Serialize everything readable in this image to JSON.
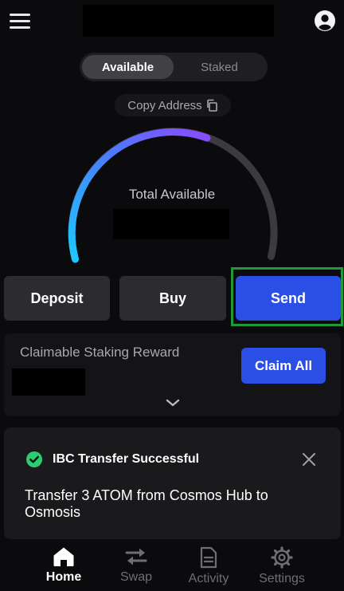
{
  "header": {
    "menu_icon": "hamburger-menu-icon",
    "profile_icon": "account-circle-icon"
  },
  "balance_tabs": [
    {
      "label": "Available",
      "active": true
    },
    {
      "label": "Staked",
      "active": false
    }
  ],
  "copy_address": {
    "label": "Copy Address",
    "icon": "copy-icon"
  },
  "gauge": {
    "label": "Total Available",
    "gradient_start": "#1ec8ff",
    "gradient_end": "#8a4bff",
    "track_color": "#3a3a40"
  },
  "actions": {
    "deposit_label": "Deposit",
    "buy_label": "Buy",
    "send_label": "Send"
  },
  "claim": {
    "label": "Claimable Staking Reward",
    "button_label": "Claim All",
    "expand_icon": "chevron-down-icon"
  },
  "toast": {
    "icon": "check-circle-icon",
    "title": "IBC Transfer Successful",
    "message": "Transfer 3 ATOM from Cosmos Hub to Osmosis",
    "close_icon": "close-icon"
  },
  "nav": [
    {
      "label": "Home",
      "icon": "home-icon",
      "active": true
    },
    {
      "label": "Swap",
      "icon": "swap-arrows-icon",
      "active": false
    },
    {
      "label": "Activity",
      "icon": "document-icon",
      "active": false
    },
    {
      "label": "Settings",
      "icon": "gear-icon",
      "active": false
    }
  ],
  "colors": {
    "background": "#0b0b0d",
    "primary_button": "#2b4fe4",
    "success": "#2ecc71",
    "highlight_frame": "#1f9a3a"
  }
}
